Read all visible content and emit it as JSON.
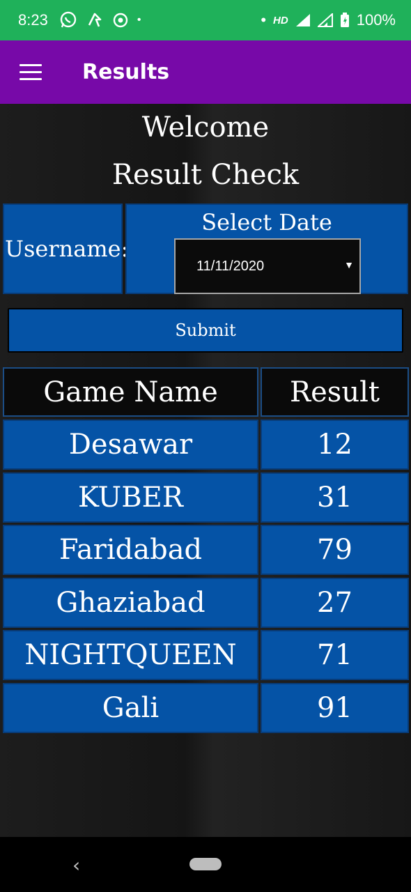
{
  "status": {
    "time": "8:23",
    "hd": "HD",
    "battery": "100%",
    "dot": "•"
  },
  "app_bar": {
    "title": "Results"
  },
  "headings": {
    "welcome": "Welcome",
    "subtitle": "Result Check"
  },
  "form": {
    "username_label": "Username:",
    "date_label": "Select Date",
    "date_value": "11/11/2020",
    "submit_label": "Submit"
  },
  "table": {
    "headers": [
      "Game Name",
      "Result"
    ],
    "rows": [
      [
        "Desawar",
        "12"
      ],
      [
        "KUBER",
        "31"
      ],
      [
        "Faridabad",
        "79"
      ],
      [
        "Ghaziabad",
        "27"
      ],
      [
        "NIGHTQUEEN",
        "71"
      ],
      [
        "Gali",
        "91"
      ]
    ]
  },
  "colors": {
    "status_bar": "#1fb15a",
    "app_bar": "#7709a8",
    "cell_blue": "#0553a6"
  }
}
